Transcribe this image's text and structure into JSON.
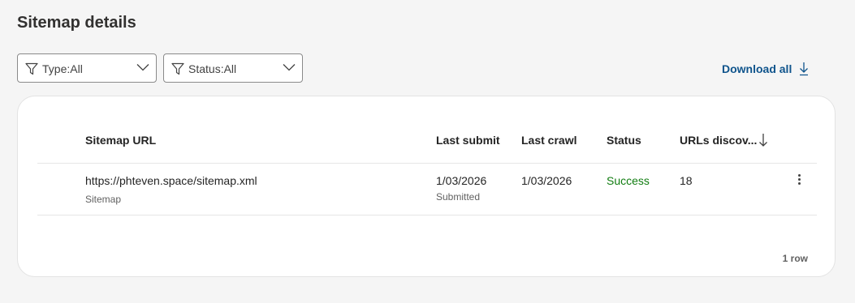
{
  "page": {
    "title": "Sitemap details"
  },
  "filters": {
    "type_label": "Type:All",
    "status_label": "Status:All"
  },
  "actions": {
    "download_all": "Download all"
  },
  "table": {
    "columns": [
      "Sitemap URL",
      "Last submit",
      "Last crawl",
      "Status",
      "URLs discov..."
    ],
    "sorted_column": "URLs discov...",
    "sort_direction": "descending",
    "rows": [
      {
        "url": "https://phteven.space/sitemap.xml",
        "type": "Sitemap",
        "last_submit": "1/03/2026",
        "submit_note": "Submitted",
        "last_crawl": "1/03/2026",
        "status": "Success",
        "urls_discovered": "18"
      }
    ],
    "row_count": "1 row"
  },
  "colors": {
    "link": "#0f548c",
    "success": "#107c10"
  },
  "icons": {
    "filter": "funnel-icon",
    "dropdown": "chevron-down-icon",
    "download": "download-arrow-icon",
    "sort": "sort-down-arrow-icon",
    "row_menu": "more-vertical-icon"
  }
}
